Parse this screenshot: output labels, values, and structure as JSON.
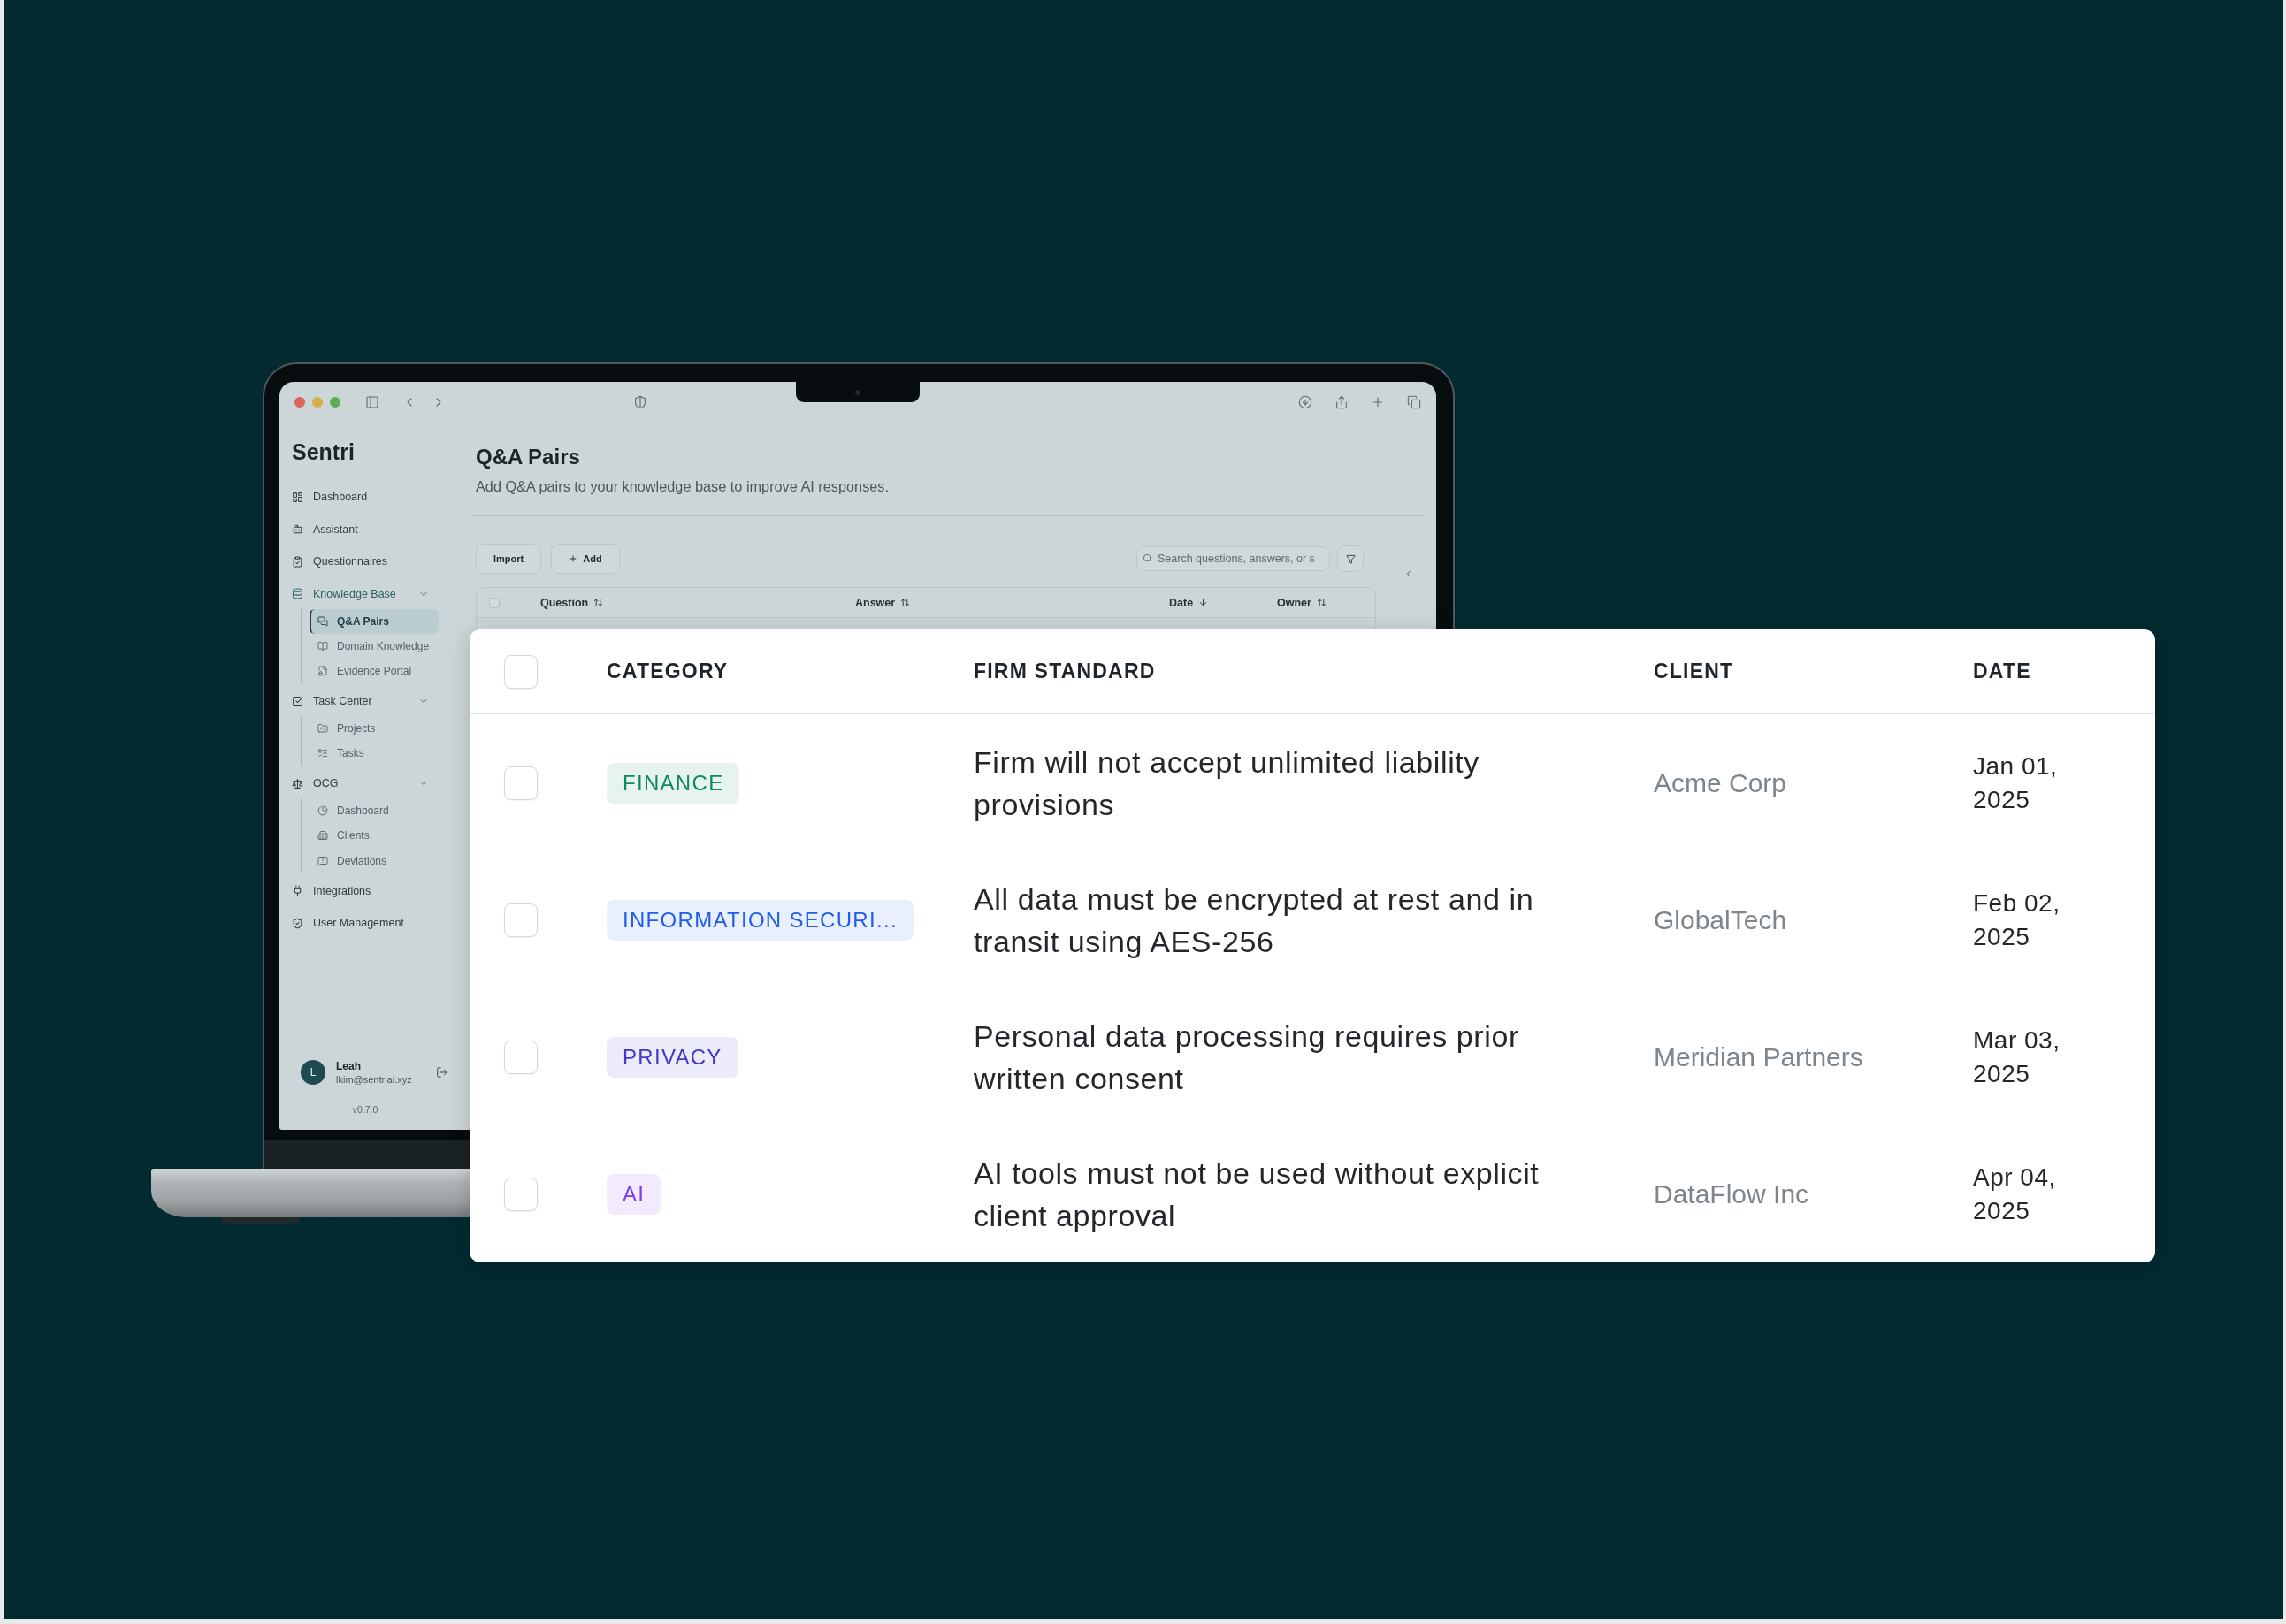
{
  "laptop": {
    "sidebar": {
      "brand": "Sentri",
      "items": [
        {
          "label": "Dashboard",
          "selected": false
        },
        {
          "label": "Assistant",
          "selected": false
        },
        {
          "label": "Questionnaires",
          "selected": false
        },
        {
          "label": "Knowledge Base",
          "selected": true,
          "expanded": true,
          "children": [
            {
              "label": "Q&A Pairs",
              "selected": true
            },
            {
              "label": "Domain Knowledge",
              "selected": false
            },
            {
              "label": "Evidence Portal",
              "selected": false
            }
          ]
        },
        {
          "label": "Task Center",
          "selected": false,
          "expanded": true,
          "children": [
            {
              "label": "Projects",
              "selected": false
            },
            {
              "label": "Tasks",
              "selected": false
            }
          ]
        },
        {
          "label": "OCG",
          "selected": false,
          "expanded": true,
          "children": [
            {
              "label": "Dashboard",
              "selected": false
            },
            {
              "label": "Clients",
              "selected": false
            },
            {
              "label": "Deviations",
              "selected": false
            }
          ]
        },
        {
          "label": "Integrations",
          "selected": false
        },
        {
          "label": "User Management",
          "selected": false
        }
      ],
      "user": {
        "initial": "L",
        "name": "Leah",
        "email": "lkim@sentriai.xyz"
      },
      "version": "v0.7.0"
    },
    "page": {
      "title": "Q&A Pairs",
      "subtitle": "Add Q&A pairs to your knowledge base to improve AI responses.",
      "actions": [
        {
          "label": "Import",
          "kind": "plain"
        },
        {
          "label": "Add",
          "kind": "add"
        }
      ],
      "search": {
        "placeholder": "Search questions, answers, or s"
      },
      "table": {
        "header_checked": false,
        "columns": [
          {
            "label": "Question",
            "kind": "sortable"
          },
          {
            "label": "Answer",
            "kind": "sortable"
          },
          {
            "label": "Date",
            "kind": "descending"
          },
          {
            "label": "Owner",
            "kind": "sortable"
          }
        ]
      }
    }
  },
  "standards_table": {
    "header_checked": false,
    "columns": [
      "CATEGORY",
      "FIRM STANDARD",
      "CLIENT",
      "DATE"
    ],
    "rows": [
      {
        "checked": false,
        "category": {
          "label": "FINANCE",
          "color": "#0f8a5c"
        },
        "standard": "Firm will not accept unlimited liability provisions",
        "client": "Acme Corp",
        "date": "Jan 01, 2025"
      },
      {
        "checked": false,
        "category": {
          "label": "INFORMATION SECURI...",
          "color": "#1f5ee8"
        },
        "standard": "All data must be encrypted at rest and in transit using AES-256",
        "client": "GlobalTech",
        "date": "Feb 02, 2025"
      },
      {
        "checked": false,
        "category": {
          "label": "PRIVACY",
          "color": "#4338ca"
        },
        "standard": "Personal data processing requires prior written consent",
        "client": "Meridian Partners",
        "date": "Mar 03, 2025"
      },
      {
        "checked": false,
        "category": {
          "label": "AI",
          "color": "#7c3aed"
        },
        "standard": "AI tools must not be used without explicit client approval",
        "client": "DataFlow Inc",
        "date": "Apr 04, 2025"
      }
    ]
  }
}
